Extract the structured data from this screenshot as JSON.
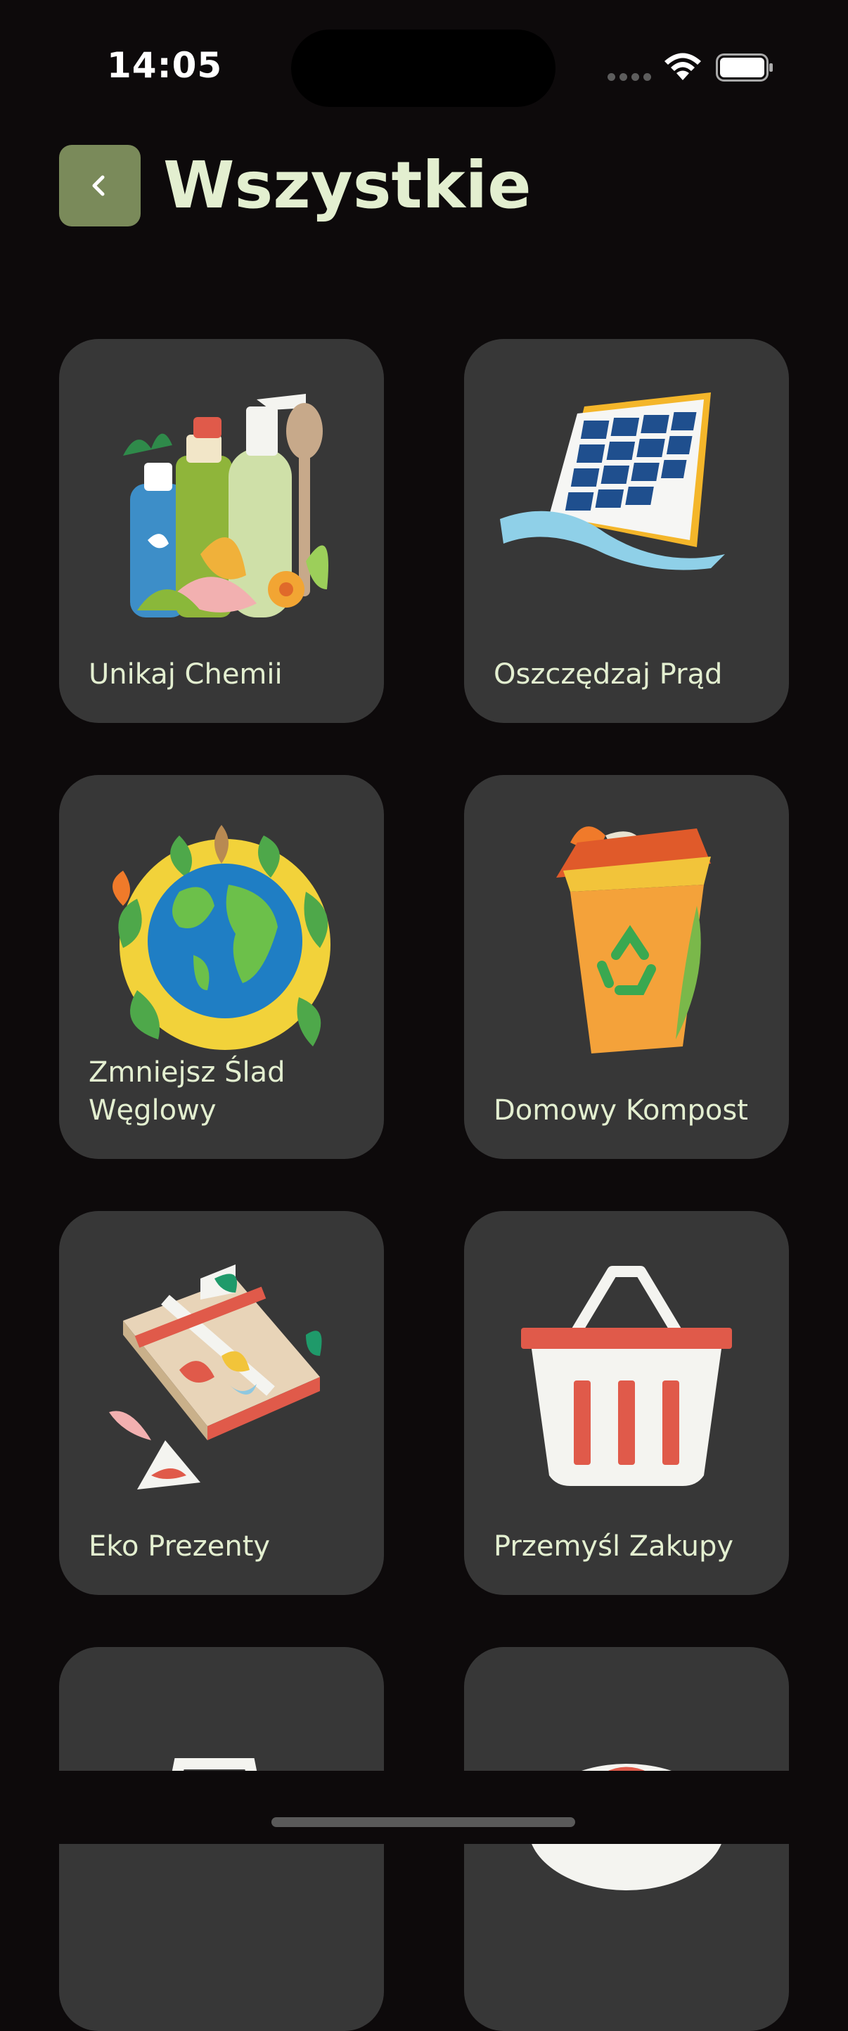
{
  "status_bar": {
    "time": "14:05"
  },
  "header": {
    "title": "Wszystkie",
    "back_icon": "chevron-left-icon"
  },
  "colors": {
    "background": "#0d0a0b",
    "card": "#373737",
    "accent": "#7a8a5a",
    "text": "#e3efd0"
  },
  "cards": [
    {
      "label": "Unikaj Chemii",
      "icon": "cleaning-bottles-icon"
    },
    {
      "label": "Oszczędzaj Prąd",
      "icon": "solar-panel-icon"
    },
    {
      "label": "Zmniejsz Ślad Węglowy",
      "icon": "earth-leaves-icon"
    },
    {
      "label": "Domowy Kompost",
      "icon": "compost-bin-icon"
    },
    {
      "label": "Eko Prezenty",
      "icon": "gift-box-icon"
    },
    {
      "label": "Przemyśl Zakupy",
      "icon": "shopping-basket-icon"
    },
    {
      "label": "",
      "icon": "bag-icon"
    },
    {
      "label": "",
      "icon": "plate-icon"
    }
  ]
}
